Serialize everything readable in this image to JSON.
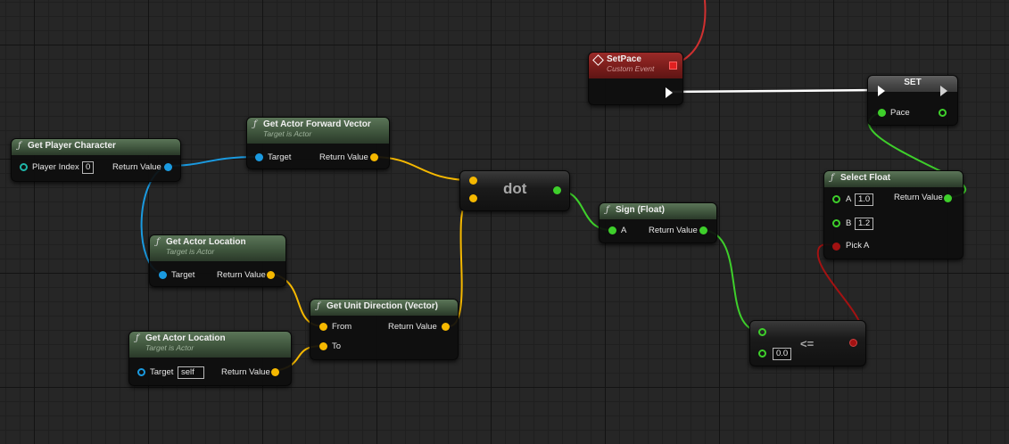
{
  "colors": {
    "object": "#1a9ae0",
    "vector": "#f5b800",
    "float": "#3ecf2b",
    "boolean": "#a31212",
    "exec": "#ffffff",
    "function_header": "#4f6a4c",
    "event_header": "#8c2220"
  },
  "icons": {
    "function": "function-icon",
    "event": "event-diamond-icon",
    "delegate": "delegate-pin-icon"
  },
  "nodes": {
    "get_player_character": {
      "title": "Get Player Character",
      "fx": "ƒ",
      "in_label": "Player Index",
      "in_value": "0",
      "out_label": "Return Value"
    },
    "forward_vector": {
      "title": "Get Actor Forward Vector",
      "subtitle": "Target is Actor",
      "fx": "ƒ",
      "in_label": "Target",
      "out_label": "Return Value"
    },
    "actor_location_1": {
      "title": "Get Actor Location",
      "subtitle": "Target is Actor",
      "fx": "ƒ",
      "in_label": "Target",
      "out_label": "Return Value"
    },
    "actor_location_2": {
      "title": "Get Actor Location",
      "subtitle": "Target is Actor",
      "fx": "ƒ",
      "in_label": "Target",
      "in_value": "self",
      "out_label": "Return Value"
    },
    "unit_direction": {
      "title": "Get Unit Direction (Vector)",
      "fx": "ƒ",
      "in_label_1": "From",
      "in_label_2": "To",
      "out_label": "Return Value"
    },
    "dot": {
      "title": "dot"
    },
    "sign": {
      "title": "Sign (Float)",
      "fx": "ƒ",
      "in_label": "A",
      "out_label": "Return Value"
    },
    "compare": {
      "title": "<=",
      "in_value": "0.0"
    },
    "set_pace_event": {
      "title": "SetPace",
      "subtitle": "Custom Event"
    },
    "set_node": {
      "title": "SET",
      "in_label": "Pace"
    },
    "select_float": {
      "title": "Select Float",
      "fx": "ƒ",
      "a_label": "A",
      "a_value": "1.0",
      "b_label": "B",
      "b_value": "1.2",
      "pick_label": "Pick A",
      "out_label": "Return Value"
    }
  }
}
